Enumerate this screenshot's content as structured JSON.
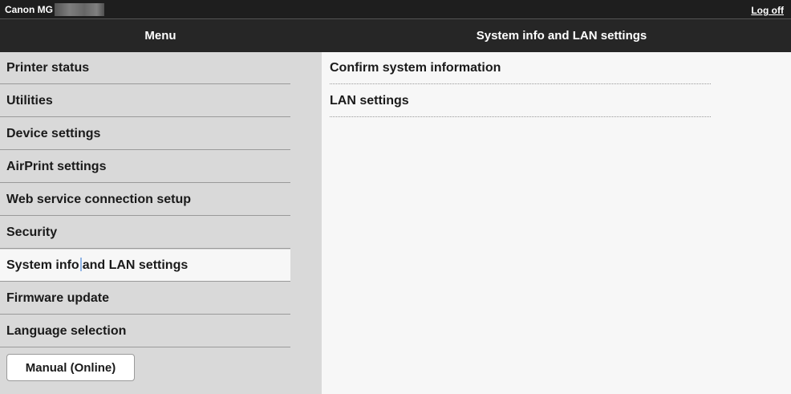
{
  "topbar": {
    "brand": "Canon MG",
    "logoff": "Log off"
  },
  "header": {
    "menu_title": "Menu",
    "section_title": "System info and LAN settings"
  },
  "sidebar": {
    "items": [
      {
        "label": "Printer status"
      },
      {
        "label": "Utilities"
      },
      {
        "label": "Device settings"
      },
      {
        "label": "AirPrint settings"
      },
      {
        "label": "Web service connection setup"
      },
      {
        "label": "Security"
      },
      {
        "label_a": "System info",
        "label_b": "and LAN settings",
        "active": true
      },
      {
        "label": "Firmware update"
      },
      {
        "label": "Language selection"
      }
    ],
    "manual_button": "Manual (Online)"
  },
  "content": {
    "items": [
      {
        "label": "Confirm system information"
      },
      {
        "label": "LAN settings"
      }
    ]
  }
}
